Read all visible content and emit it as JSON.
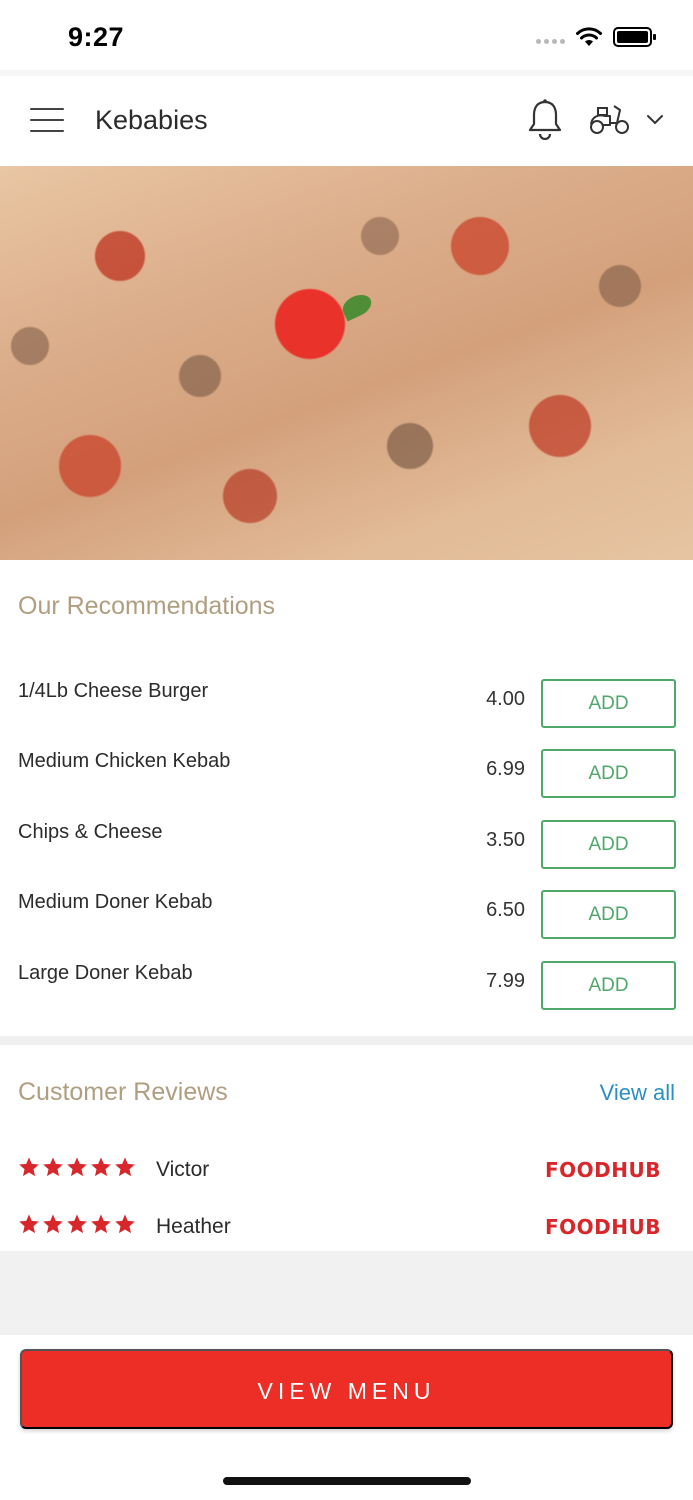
{
  "status_bar": {
    "time": "9:27"
  },
  "header": {
    "title": "Kebabies",
    "menu_icon": "hamburger-icon",
    "notification_icon": "bell-icon",
    "delivery_icon": "scooter-icon",
    "dropdown_icon": "chevron-down-icon"
  },
  "recommendations": {
    "title": "Our Recommendations",
    "items": [
      {
        "name": "1/4Lb Cheese Burger",
        "price": "4.00",
        "button": "ADD"
      },
      {
        "name": "Medium Chicken Kebab",
        "price": "6.99",
        "button": "ADD"
      },
      {
        "name": "Chips & Cheese",
        "price": "3.50",
        "button": "ADD"
      },
      {
        "name": "Medium Doner Kebab",
        "price": "6.50",
        "button": "ADD"
      },
      {
        "name": "Large Doner Kebab",
        "price": "7.99",
        "button": "ADD"
      }
    ]
  },
  "reviews": {
    "title": "Customer Reviews",
    "view_all": "View all",
    "items": [
      {
        "name": "Victor",
        "rating": 5,
        "source": "FOODHUB"
      },
      {
        "name": "Heather",
        "rating": 5,
        "source": "FOODHUB"
      }
    ]
  },
  "footer": {
    "view_menu": "VIEW MENU"
  },
  "colors": {
    "accent_red": "#ec2e27",
    "add_green": "#4fa86a",
    "section_title": "#b09e80",
    "link_blue": "#2b8fc4",
    "star_red": "#d9262a"
  }
}
